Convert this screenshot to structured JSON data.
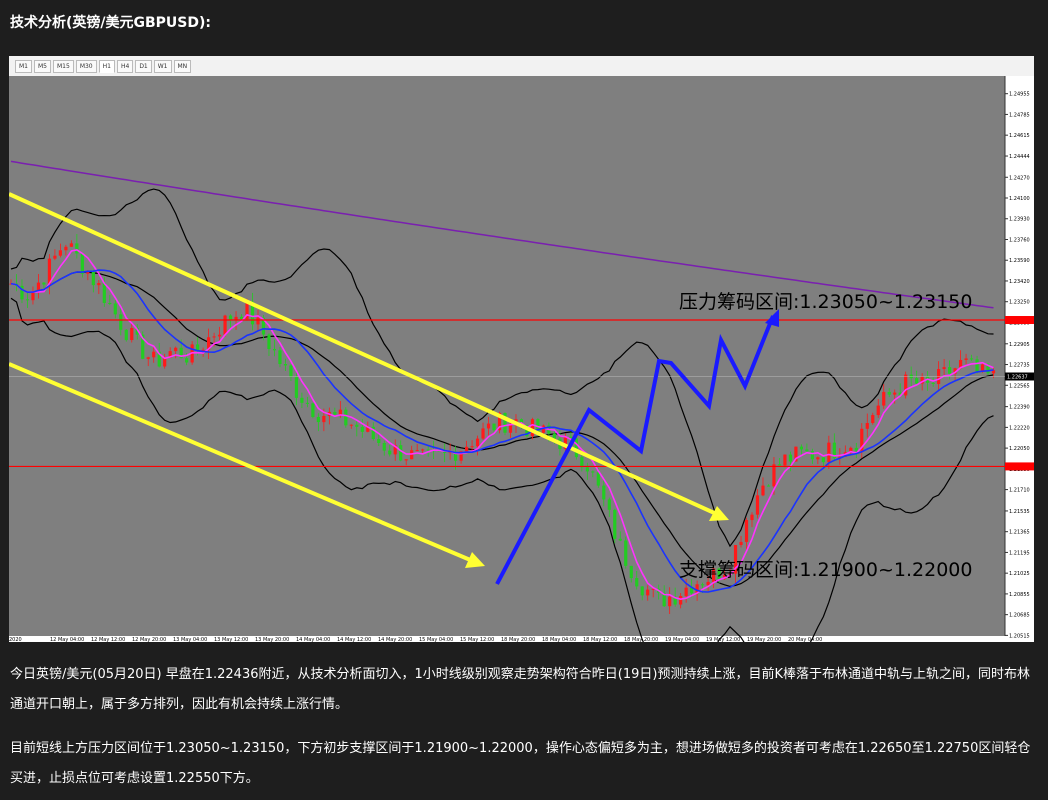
{
  "header": {
    "title": "技术分析(英镑/美元GBPUSD):"
  },
  "chart_toolbar": {
    "tabs": [
      "M1",
      "M5",
      "M15",
      "M30",
      "H1",
      "H4",
      "D1",
      "W1",
      "MN"
    ],
    "active": "H1"
  },
  "colors": {
    "chart_bg": "#7f7f7f",
    "candle_up": "#ff1a1a",
    "candle_down": "#22cc22",
    "channel": "#ffff33",
    "arrow": "#1a1aff",
    "bollinger": "#000000",
    "ma_long": "#7a1fb0",
    "ma_fast": "#ff33ff",
    "ma_mid": "#1a33ff",
    "level_line": "#ff0000"
  },
  "chart_data": {
    "type": "candlestick",
    "symbol": "GBPUSD",
    "timeframe": "H1",
    "ylim": [
      1.2051,
      1.251
    ],
    "y_ticks": [
      "1.24955",
      "1.24785",
      "1.24615",
      "1.24444",
      "1.24270",
      "1.24100",
      "1.23930",
      "1.23760",
      "1.23590",
      "1.23420",
      "1.23250",
      "1.23080",
      "1.22905",
      "1.22735",
      "1.22565",
      "1.22390",
      "1.22220",
      "1.22050",
      "1.21880",
      "1.21710",
      "1.21535",
      "1.21365",
      "1.21195",
      "1.21025",
      "1.20855",
      "1.20685",
      "1.20515"
    ],
    "current_price": "1.22637",
    "x_labels": [
      "2020",
      "12 May 04:00",
      "12 May 12:00",
      "12 May 20:00",
      "13 May 04:00",
      "13 May 12:00",
      "13 May 20:00",
      "14 May 04:00",
      "14 May 12:00",
      "14 May 20:00",
      "15 May 04:00",
      "15 May 12:00",
      "18 May 20:00",
      "18 May 04:00",
      "18 May 12:00",
      "18 May 20:00",
      "19 May 04:00",
      "19 May 12:00",
      "19 May 20:00",
      "20 May 04:00"
    ],
    "resistance_line": 1.231,
    "support_line": 1.219,
    "resistance_label": "压力筹码区间:1.23050~1.23150",
    "support_label": "支撑筹码区间:1.21900~1.22000",
    "price_path": [
      [
        0,
        1.234
      ],
      [
        3,
        1.233
      ],
      [
        6,
        1.235
      ],
      [
        9,
        1.2375
      ],
      [
        12,
        1.2355
      ],
      [
        15,
        1.2335
      ],
      [
        18,
        1.231
      ],
      [
        21,
        1.229
      ],
      [
        24,
        1.2275
      ],
      [
        27,
        1.2285
      ],
      [
        30,
        1.228
      ],
      [
        33,
        1.2295
      ],
      [
        36,
        1.231
      ],
      [
        39,
        1.232
      ],
      [
        42,
        1.23
      ],
      [
        45,
        1.2275
      ],
      [
        48,
        1.225
      ],
      [
        51,
        1.2235
      ],
      [
        54,
        1.223
      ],
      [
        57,
        1.2225
      ],
      [
        60,
        1.2215
      ],
      [
        63,
        1.2205
      ],
      [
        66,
        1.22
      ],
      [
        69,
        1.2195
      ],
      [
        72,
        1.2198
      ],
      [
        75,
        1.2205
      ],
      [
        78,
        1.2215
      ],
      [
        81,
        1.2225
      ],
      [
        84,
        1.2228
      ],
      [
        87,
        1.222
      ],
      [
        90,
        1.2215
      ],
      [
        93,
        1.2208
      ],
      [
        96,
        1.2195
      ],
      [
        99,
        1.216
      ],
      [
        102,
        1.212
      ],
      [
        105,
        1.2095
      ],
      [
        108,
        1.208
      ],
      [
        111,
        1.2085
      ],
      [
        114,
        1.2095
      ],
      [
        117,
        1.21
      ],
      [
        120,
        1.211
      ],
      [
        123,
        1.215
      ],
      [
        126,
        1.218
      ],
      [
        129,
        1.2195
      ],
      [
        132,
        1.22
      ],
      [
        135,
        1.22
      ],
      [
        138,
        1.2205
      ],
      [
        141,
        1.221
      ],
      [
        144,
        1.2235
      ],
      [
        147,
        1.225
      ],
      [
        150,
        1.226
      ],
      [
        153,
        1.2255
      ],
      [
        156,
        1.2265
      ],
      [
        159,
        1.2275
      ],
      [
        162,
        1.2265
      ],
      [
        165,
        1.2262
      ]
    ],
    "n_bars": 180
  },
  "body": {
    "p1": "今日英镑/美元(05月20日) 早盘在1.22436附近，从技术分析面切入，1小时线级别观察走势架构符合昨日(19日)预测持续上涨，目前K棒落于布林通道中轨与上轨之间，同时布林通道开口朝上，属于多方排列，因此有机会持续上涨行情。",
    "p2": "目前短线上方压力区间位于1.23050~1.23150，下方初步支撑区间于1.21900~1.22000，操作心态偏短多为主，想进场做短多的投资者可考虑在1.22650至1.22750区间轻仓买进，止损点位可考虑设置1.22550下方。"
  }
}
